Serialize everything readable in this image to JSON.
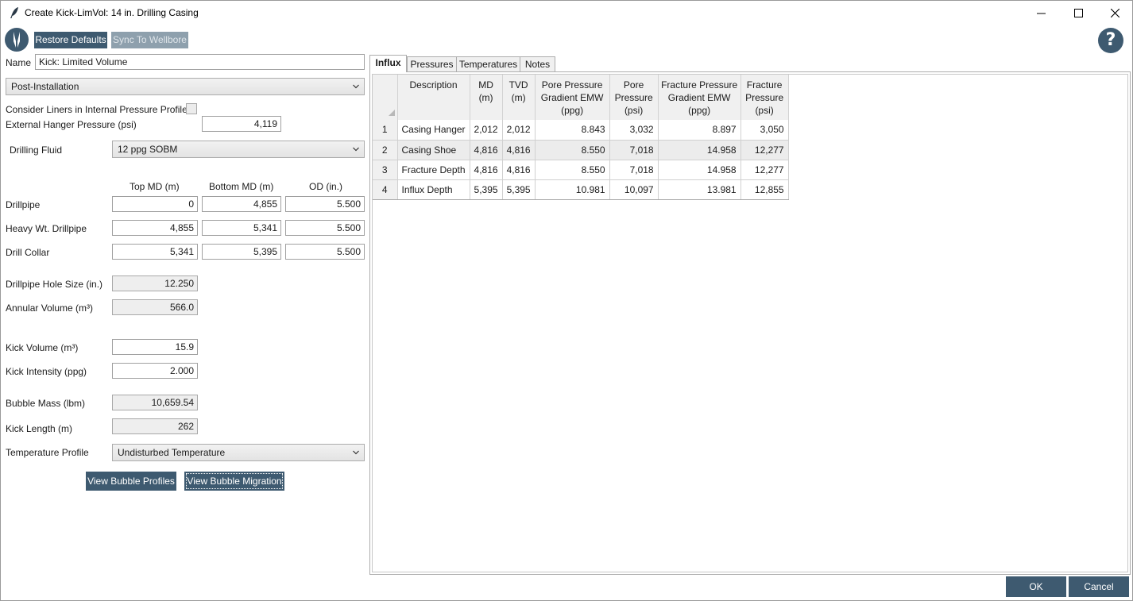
{
  "window": {
    "title": "Create Kick-LimVol: 14 in. Drilling Casing"
  },
  "toolbar": {
    "restore_defaults": "Restore Defaults",
    "sync_to_wellbore": "Sync To Wellbore"
  },
  "form": {
    "name_label": "Name",
    "name_value": "Kick: Limited Volume",
    "phase": "Post-Installation",
    "consider_liners_label": "Consider Liners in Internal Pressure Profile",
    "ext_hanger_label": "External Hanger Pressure (psi)",
    "ext_hanger_value": "4,119",
    "drilling_fluid_label": "Drilling Fluid",
    "drilling_fluid_value": "12 ppg SOBM",
    "col_top_md": "Top MD (m)",
    "col_bottom_md": "Bottom MD (m)",
    "col_od": "OD (in.)",
    "string_rows": [
      {
        "label": "Drillpipe",
        "top": "0",
        "bottom": "4,855",
        "od": "5.500"
      },
      {
        "label": "Heavy Wt. Drillpipe",
        "top": "4,855",
        "bottom": "5,341",
        "od": "5.500"
      },
      {
        "label": "Drill Collar",
        "top": "5,341",
        "bottom": "5,395",
        "od": "5.500"
      }
    ],
    "hole_size_label": "Drillpipe Hole Size (in.)",
    "hole_size_value": "12.250",
    "annular_volume_label": "Annular Volume (m³)",
    "annular_volume_value": "566.0",
    "kick_volume_label": "Kick Volume (m³)",
    "kick_volume_value": "15.9",
    "kick_intensity_label": "Kick Intensity (ppg)",
    "kick_intensity_value": "2.000",
    "bubble_mass_label": "Bubble Mass (lbm)",
    "bubble_mass_value": "10,659.54",
    "kick_length_label": "Kick Length (m)",
    "kick_length_value": "262",
    "temp_profile_label": "Temperature Profile",
    "temp_profile_value": "Undisturbed Temperature",
    "view_profiles": "View Bubble Profiles",
    "view_migration": "View Bubble Migration"
  },
  "tabs": [
    {
      "label": "Influx"
    },
    {
      "label": "Pressures"
    },
    {
      "label": "Temperatures"
    },
    {
      "label": "Notes"
    }
  ],
  "grid": {
    "headers": {
      "description": "Description",
      "md": [
        "MD",
        "(m)"
      ],
      "tvd": [
        "TVD",
        "(m)"
      ],
      "ppg": [
        "Pore Pressure",
        "Gradient EMW",
        "(ppg)"
      ],
      "pp": [
        "Pore",
        "Pressure",
        "(psi)"
      ],
      "fpg": [
        "Fracture Pressure",
        "Gradient EMW",
        "(ppg)"
      ],
      "fp": [
        "Fracture",
        "Pressure",
        "(psi)"
      ]
    },
    "rows": [
      {
        "n": "1",
        "desc": "Casing Hanger",
        "md": "2,012",
        "tvd": "2,012",
        "ppg": "8.843",
        "pp": "3,032",
        "fpg": "8.897",
        "fp": "3,050"
      },
      {
        "n": "2",
        "desc": "Casing Shoe",
        "md": "4,816",
        "tvd": "4,816",
        "ppg": "8.550",
        "pp": "7,018",
        "fpg": "14.958",
        "fp": "12,277"
      },
      {
        "n": "3",
        "desc": "Fracture Depth",
        "md": "4,816",
        "tvd": "4,816",
        "ppg": "8.550",
        "pp": "7,018",
        "fpg": "14.958",
        "fp": "12,277"
      },
      {
        "n": "4",
        "desc": "Influx Depth",
        "md": "5,395",
        "tvd": "5,395",
        "ppg": "10.981",
        "pp": "10,097",
        "fpg": "13.981",
        "fp": "12,855"
      }
    ]
  },
  "footer": {
    "ok": "OK",
    "cancel": "Cancel"
  },
  "help": {
    "glyph": "?"
  },
  "colors": {
    "accent": "#3e5a70"
  }
}
